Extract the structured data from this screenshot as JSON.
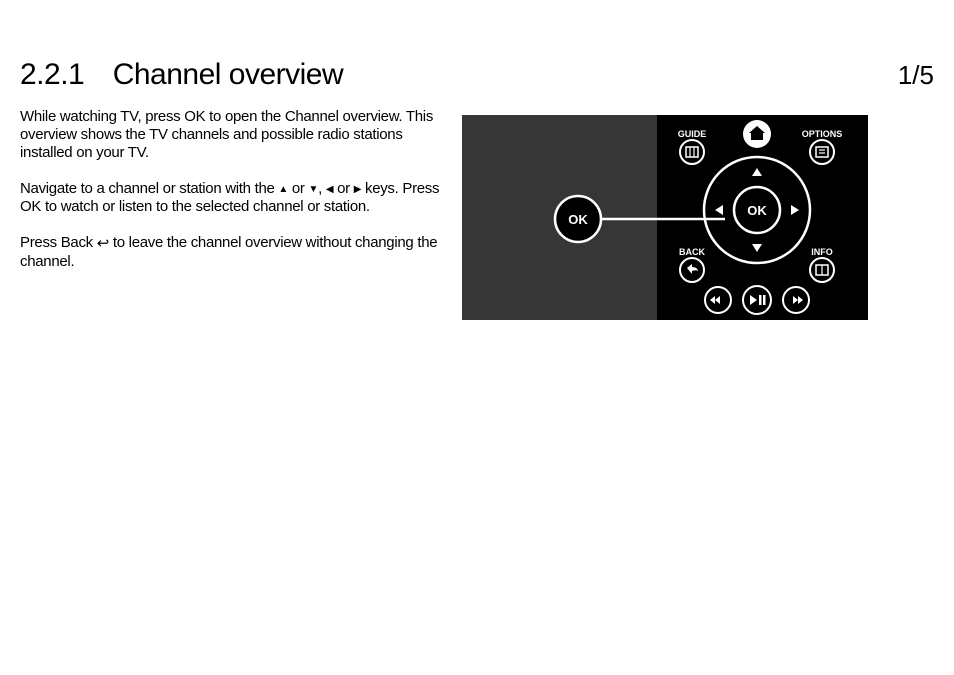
{
  "header": {
    "section_number": "2.2.1",
    "section_title": "Channel overview",
    "page_indicator": "1/5"
  },
  "body": {
    "p1": "While watching TV, press OK to open the Channel overview. This overview shows the TV channels and possible radio stations installed on your TV.",
    "p2_a": "Navigate to a channel or station with the ",
    "p2_b": " or ",
    "p2_c": ", ",
    "p2_d": " or ",
    "p2_e": " keys. Press OK to watch or listen to the selected channel or station.",
    "p3_a": "Press Back ",
    "p3_b": " to leave the channel overview without changing the channel."
  },
  "glyphs": {
    "up": "▲",
    "down": "▼",
    "left": "◀",
    "right": "▶",
    "back": "↩"
  },
  "remote": {
    "callout": "OK",
    "center": "OK",
    "labels": {
      "guide": "GUIDE",
      "options": "OPTIONS",
      "back": "BACK",
      "info": "INFO"
    }
  }
}
